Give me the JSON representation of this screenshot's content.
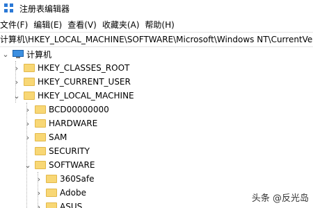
{
  "window": {
    "title": "注册表编辑器"
  },
  "menu": [
    "文件(F)",
    "编辑(E)",
    "查看(V)",
    "收藏夹(A)",
    "帮助(H)"
  ],
  "address": "计算机\\HKEY_LOCAL_MACHINE\\SOFTWARE\\Microsoft\\Windows NT\\CurrentVe",
  "tree": {
    "root": "计算机",
    "hives": [
      "HKEY_CLASSES_ROOT",
      "HKEY_CURRENT_USER",
      "HKEY_LOCAL_MACHINE"
    ],
    "hklm_children": [
      "BCD00000000",
      "HARDWARE",
      "SAM",
      "SECURITY",
      "SOFTWARE"
    ],
    "software_children": [
      "360Safe",
      "Adobe",
      "ASUS"
    ]
  },
  "watermark": "头条 @反光岛",
  "colors": {
    "folder": "#f8d775",
    "accent": "#2b79d6"
  }
}
